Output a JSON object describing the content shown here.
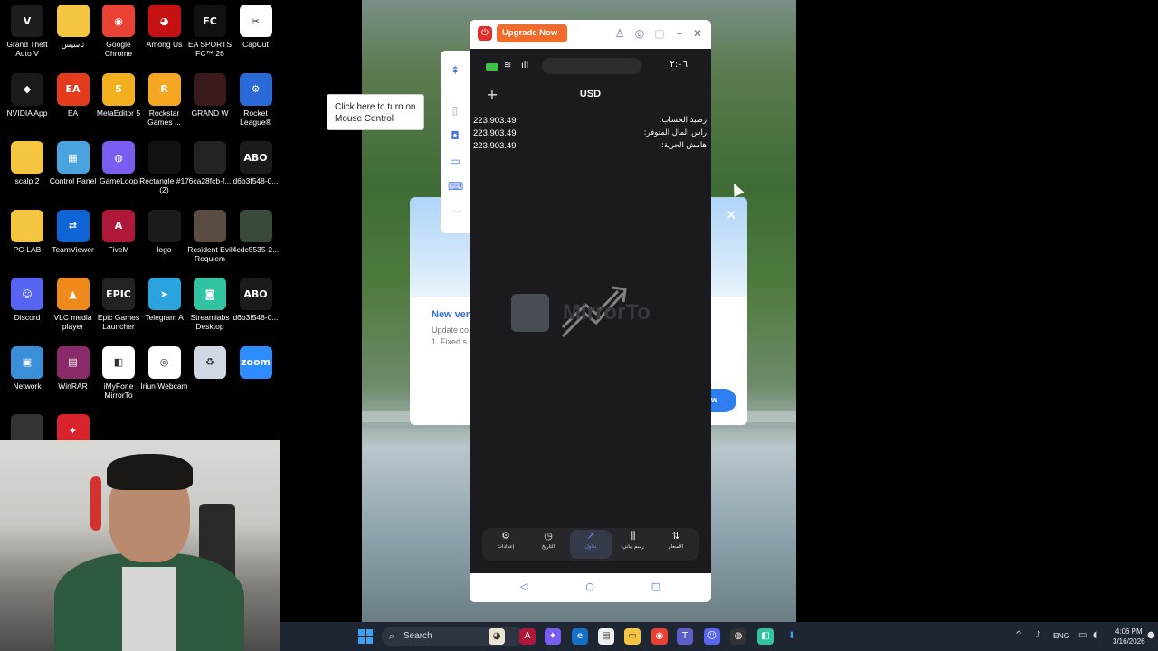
{
  "desktop": {
    "icons": [
      {
        "label": "Grand Theft Auto V",
        "color": "#1d1d1d",
        "glyph": "V"
      },
      {
        "label": "تاسيس",
        "color": "#f5c542",
        "glyph": ""
      },
      {
        "label": "Google Chrome",
        "color": "#e94235",
        "glyph": "◉"
      },
      {
        "label": "Among Us",
        "color": "#c51111",
        "glyph": "◕"
      },
      {
        "label": "EA SPORTS FC™ 26",
        "color": "#111111",
        "glyph": "FC"
      },
      {
        "label": "CapCut",
        "color": "#ffffff",
        "glyph": "✂"
      },
      {
        "label": "NVIDIA App",
        "color": "#1a1a1a",
        "glyph": "◆"
      },
      {
        "label": "EA",
        "color": "#e33b1b",
        "glyph": "EA"
      },
      {
        "label": "MetaEditor 5",
        "color": "#f2b01e",
        "glyph": "5"
      },
      {
        "label": "Rockstar Games ...",
        "color": "#f5a623",
        "glyph": "R"
      },
      {
        "label": "GRAND W",
        "color": "#3a1a1a",
        "glyph": ""
      },
      {
        "label": "Rocket League®",
        "color": "#2a6ad8",
        "glyph": "⚙"
      },
      {
        "label": "scalp 2",
        "color": "#f5c542",
        "glyph": ""
      },
      {
        "label": "Control Panel",
        "color": "#4aa3df",
        "glyph": "▦"
      },
      {
        "label": "GameLoop",
        "color": "#7b5cf0",
        "glyph": "◍"
      },
      {
        "label": "Rectangle #17 (2)",
        "color": "#111111",
        "glyph": ""
      },
      {
        "label": "6ca28fcb-f...",
        "color": "#222222",
        "glyph": ""
      },
      {
        "label": "d6b3f548-0...",
        "color": "#1a1a1a",
        "glyph": "ABO"
      },
      {
        "label": "PC-LAB",
        "color": "#f5c542",
        "glyph": ""
      },
      {
        "label": "TeamViewer",
        "color": "#0e64d4",
        "glyph": "⇄"
      },
      {
        "label": "FiveM",
        "color": "#b0183a",
        "glyph": "A"
      },
      {
        "label": "logo",
        "color": "#1b1b1b",
        "glyph": ""
      },
      {
        "label": "Resident Evil Requiem",
        "color": "#5a4c40",
        "glyph": ""
      },
      {
        "label": "4cdc5535-2...",
        "color": "#3a4a3a",
        "glyph": ""
      },
      {
        "label": "Discord",
        "color": "#5865f2",
        "glyph": "☺"
      },
      {
        "label": "VLC media player",
        "color": "#f08a1c",
        "glyph": "▲"
      },
      {
        "label": "Epic Games Launcher",
        "color": "#222222",
        "glyph": "EPIC"
      },
      {
        "label": "Telegram A",
        "color": "#2aa3df",
        "glyph": "➤"
      },
      {
        "label": "Streamlabs Desktop",
        "color": "#31c3a2",
        "glyph": "◙"
      },
      {
        "label": "d6b3f548-0...",
        "color": "#1a1a1a",
        "glyph": "ABO"
      },
      {
        "label": "Network",
        "color": "#3b8ed8",
        "glyph": "▣"
      },
      {
        "label": "WinRAR",
        "color": "#8a2a6a",
        "glyph": "▤"
      },
      {
        "label": "iMyFone MirrorTo",
        "color": "#ffffff",
        "glyph": "◧"
      },
      {
        "label": "Iriun Webcam",
        "color": "#ffffff",
        "glyph": "◎"
      },
      {
        "label": "",
        "color": "#cfd8e3",
        "glyph": "♻"
      },
      {
        "label": "",
        "color": "#2d8cff",
        "glyph": "zoom"
      },
      {
        "label": "",
        "color": "#333333",
        "glyph": ""
      },
      {
        "label": "",
        "color": "#d8232a",
        "glyph": "✦"
      }
    ]
  },
  "tooltip": {
    "line1": "Click here to turn on",
    "line2": "Mouse Control"
  },
  "update_dialog": {
    "title": "New vers",
    "line1": "Update co",
    "line2": "1.  Fixed s",
    "close": "×",
    "button": "low"
  },
  "mirror": {
    "upgrade_label": "Upgrade Now",
    "phone": {
      "time": "٢:٠٦",
      "currency": "USD",
      "rows": [
        {
          "label": "رصيد الحساب:",
          "value": "223,903.49"
        },
        {
          "label": "راس المال المتوفر:",
          "value": "223,903.49"
        },
        {
          "label": "هامش الحرية:",
          "value": "223,903.49"
        }
      ],
      "watermark": "MirrorTo",
      "nav": [
        {
          "label": "إعدادات",
          "icon": "⚙"
        },
        {
          "label": "التاريخ",
          "icon": "◷"
        },
        {
          "label": "تداول",
          "icon": "↗"
        },
        {
          "label": "رسم بياني",
          "icon": "⫼"
        },
        {
          "label": "الأسعار",
          "icon": "⇅"
        }
      ]
    }
  },
  "taskbar": {
    "search_placeholder": "Search",
    "lang": "ENG",
    "time": "4:06 PM",
    "date": "3/16/2026"
  }
}
